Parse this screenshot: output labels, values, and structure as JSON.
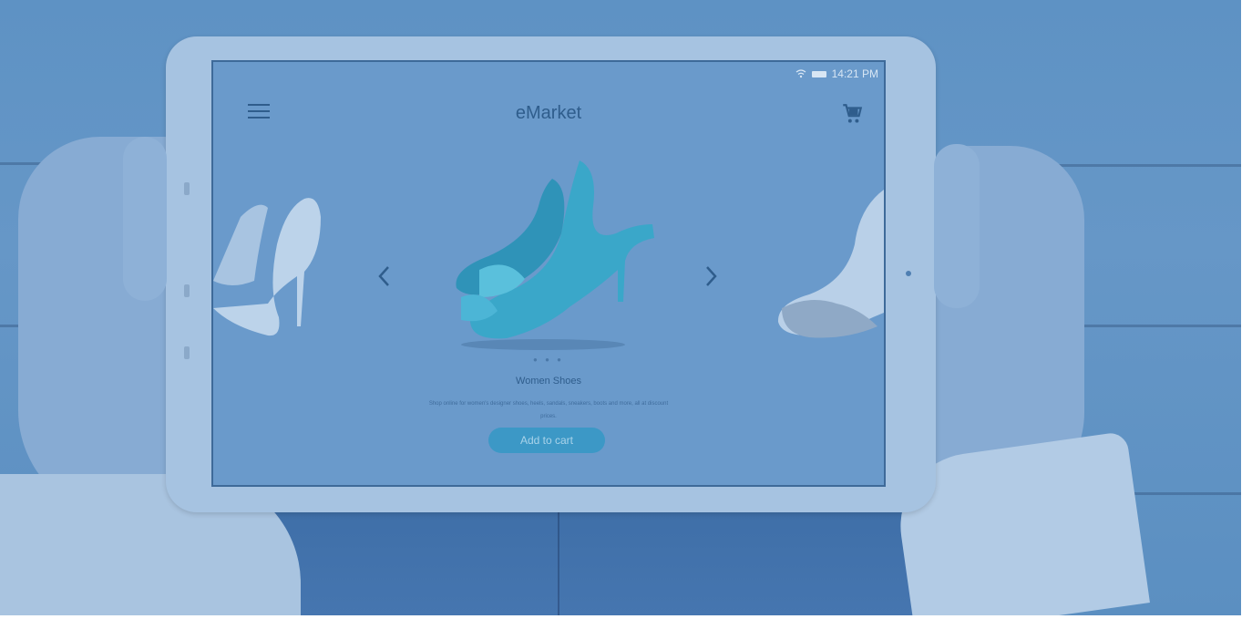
{
  "status_bar": {
    "time": "14:21 PM"
  },
  "app": {
    "title": "eMarket"
  },
  "icons": {
    "menu": "hamburger-menu-icon",
    "cart": "shopping-cart-icon",
    "prev": "chevron-left-icon",
    "next": "chevron-right-icon",
    "wifi": "wifi-icon",
    "battery": "battery-icon"
  },
  "carousel": {
    "active_slide": 2,
    "slide_count": 3
  },
  "product": {
    "title": "Women Shoes",
    "description": "Shop online for women's designer shoes, heels, sandals, sneakers, boots and more, all at discount prices.",
    "cta_label": "Add to cart"
  },
  "colors": {
    "accent": "#3c98c6",
    "overlay": "#5e92c4",
    "title_text": "#2f5d8c"
  }
}
